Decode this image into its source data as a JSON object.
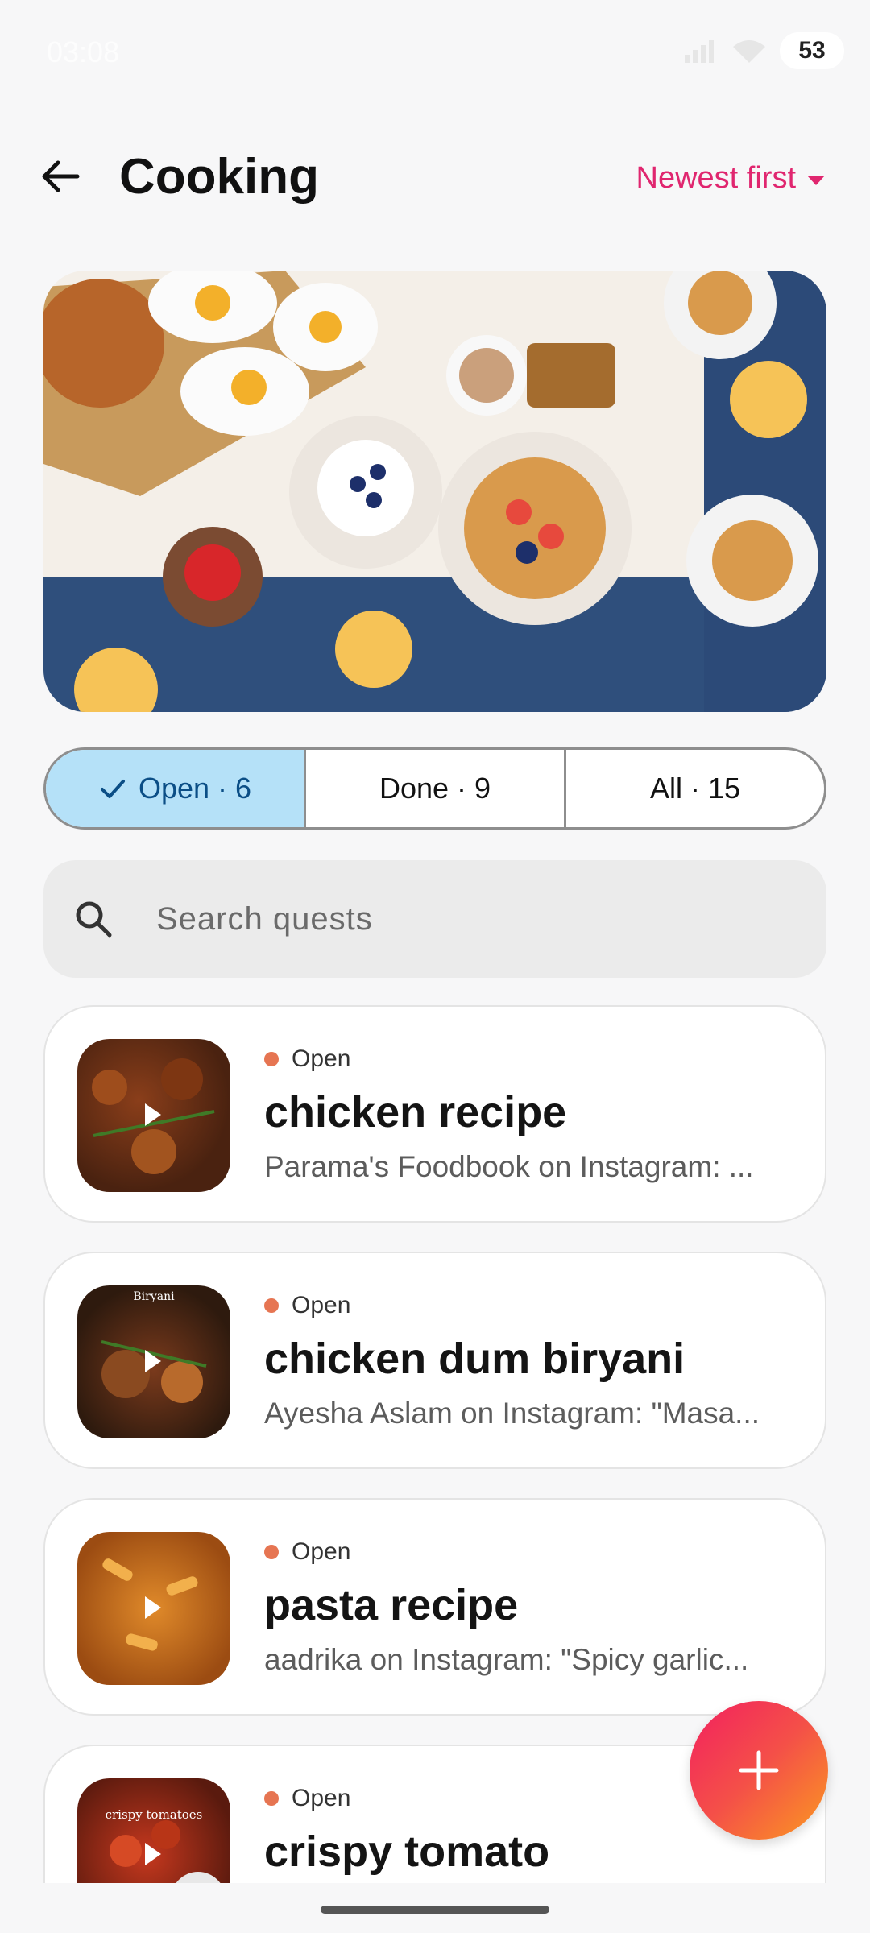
{
  "status_bar": {
    "time": "03:08",
    "battery": "53"
  },
  "header": {
    "title": "Cooking",
    "sort_label": "Newest first"
  },
  "filters": [
    {
      "label": "Open · 6",
      "active": true
    },
    {
      "label": "Done · 9",
      "active": false
    },
    {
      "label": "All · 15",
      "active": false
    }
  ],
  "search": {
    "placeholder": "Search quests"
  },
  "items": [
    {
      "status": "Open",
      "title": "chicken recipe",
      "subtitle": "Parama's Foodbook on Instagram: ..."
    },
    {
      "status": "Open",
      "title": "chicken dum biryani",
      "subtitle": "Ayesha Aslam on Instagram: \"Masa..."
    },
    {
      "status": "Open",
      "title": "pasta recipe",
      "subtitle": "aadrika on Instagram: \"Spicy garlic..."
    },
    {
      "status": "Open",
      "title": "crispy tomato",
      "subtitle": ""
    }
  ],
  "thumb_overlay_text": {
    "item1": "Biryani",
    "item3": "crispy tomatoes"
  },
  "colors": {
    "accent": "#e0266f",
    "status_dot": "#e67552",
    "active_filter": "#b5e1f8",
    "fab_start": "#f2205f",
    "fab_end": "#fb9a20"
  },
  "icons": {
    "back": "arrow-left-icon",
    "sort": "caret-down-icon",
    "check": "check-icon",
    "search": "search-icon",
    "play": "play-icon",
    "fab": "plus-icon"
  }
}
